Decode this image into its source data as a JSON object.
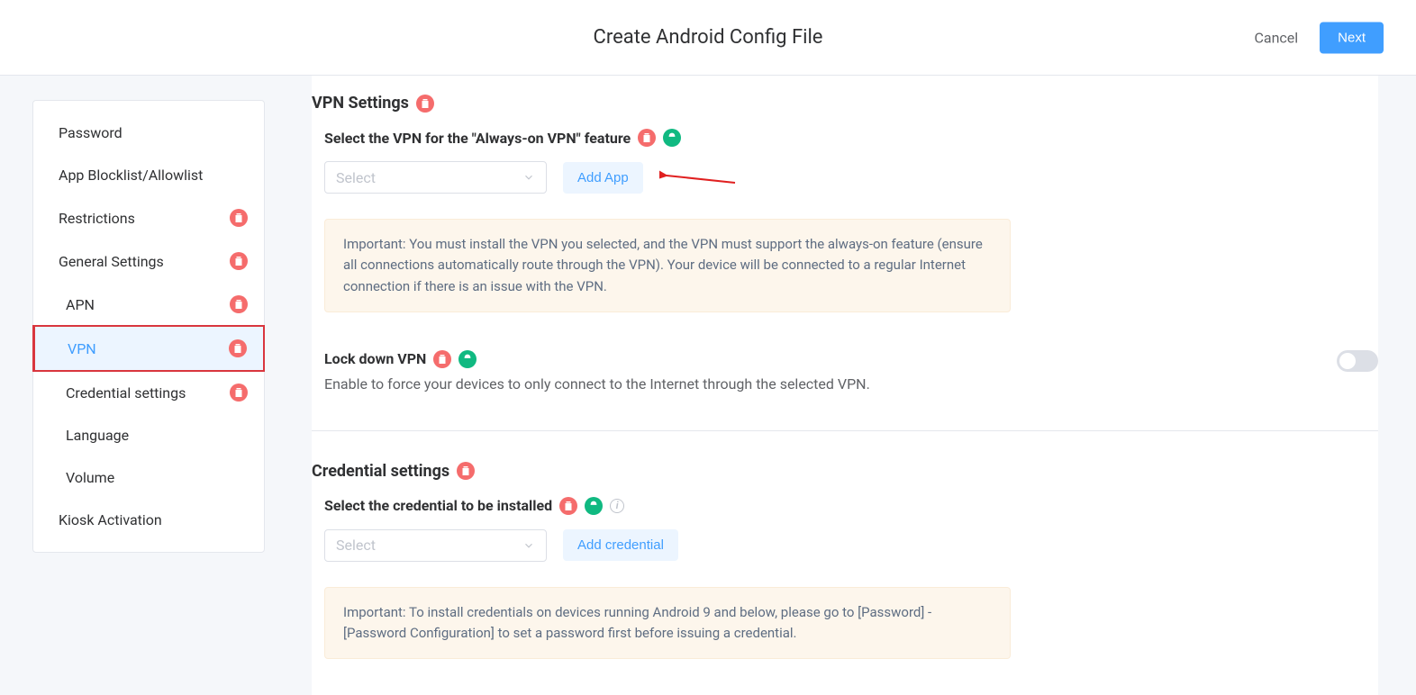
{
  "header": {
    "title": "Create Android Config File",
    "cancel": "Cancel",
    "next": "Next"
  },
  "sidebar": {
    "items": [
      {
        "label": "Password",
        "indent": false,
        "badge": false,
        "active": false
      },
      {
        "label": "App Blocklist/Allowlist",
        "indent": false,
        "badge": false,
        "active": false
      },
      {
        "label": "Restrictions",
        "indent": false,
        "badge": true,
        "active": false
      },
      {
        "label": "General Settings",
        "indent": false,
        "badge": true,
        "active": false
      },
      {
        "label": "APN",
        "indent": true,
        "badge": true,
        "active": false
      },
      {
        "label": "VPN",
        "indent": true,
        "badge": true,
        "active": true
      },
      {
        "label": "Credential settings",
        "indent": true,
        "badge": true,
        "active": false
      },
      {
        "label": "Language",
        "indent": true,
        "badge": false,
        "active": false
      },
      {
        "label": "Volume",
        "indent": true,
        "badge": false,
        "active": false
      },
      {
        "label": "Kiosk Activation",
        "indent": false,
        "badge": false,
        "active": false
      }
    ]
  },
  "vpn": {
    "section_title": "VPN Settings",
    "select_label": "Select the VPN for the \"Always-on VPN\" feature",
    "select_placeholder": "Select",
    "add_app": "Add App",
    "alert": "Important: You must install the VPN you selected, and the VPN must support the always-on feature (ensure all connections automatically route through the VPN). Your device will be connected to a regular Internet connection if there is an issue with the VPN.",
    "lockdown_title": "Lock down VPN",
    "lockdown_desc": "Enable to force your devices to only connect to the Internet through the selected VPN."
  },
  "cred": {
    "section_title": "Credential settings",
    "select_label": "Select the credential to be installed",
    "select_placeholder": "Select",
    "add_credential": "Add credential",
    "alert": "Important: To install credentials on devices running Android 9 and below, please go to [Password] - [Password Configuration] to set a password first before issuing a credential."
  }
}
